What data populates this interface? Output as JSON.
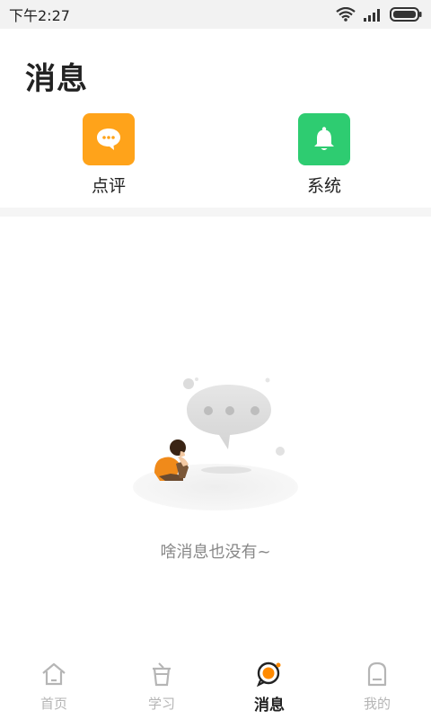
{
  "status_bar": {
    "time": "下午2:27",
    "icons": [
      "wifi-icon",
      "signal-icon",
      "battery-icon"
    ]
  },
  "page": {
    "title": "消息"
  },
  "categories": [
    {
      "label": "点评",
      "icon": "chat-bubble-icon",
      "color": "#FFA31A"
    },
    {
      "label": "系统",
      "icon": "bell-icon",
      "color": "#2ECC71"
    }
  ],
  "empty_state": {
    "message": "啥消息也没有~",
    "illustration": "sad-person-with-chat-bubble"
  },
  "tabbar": {
    "items": [
      {
        "label": "首页",
        "icon": "home-icon",
        "active": false
      },
      {
        "label": "学习",
        "icon": "cup-icon",
        "active": false
      },
      {
        "label": "消息",
        "icon": "message-icon",
        "active": true
      },
      {
        "label": "我的",
        "icon": "profile-icon",
        "active": false
      }
    ],
    "active_color": "#222222",
    "accent_color": "#FF8A00",
    "inactive_color": "#B5B5B5"
  }
}
